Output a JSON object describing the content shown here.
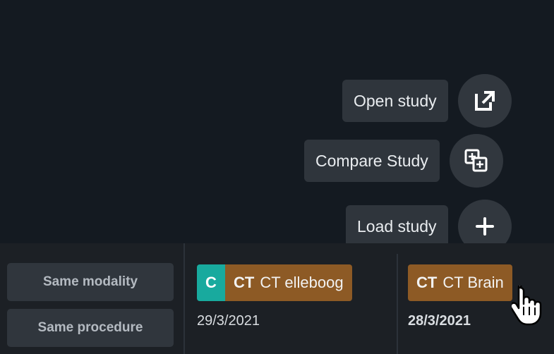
{
  "actions": {
    "open": {
      "label": "Open study",
      "icon": "external-link-icon"
    },
    "compare": {
      "label": "Compare Study",
      "icon": "compare-icon"
    },
    "load": {
      "label": "Load study",
      "icon": "plus-icon"
    }
  },
  "filters": {
    "same_modality": "Same modality",
    "same_procedure": "Same procedure"
  },
  "studies": [
    {
      "compare_badge": "C",
      "modality": "CT",
      "description": "CT elleboog",
      "date": "29/3/2021"
    },
    {
      "modality": "CT",
      "description": "CT Brain",
      "date": "28/3/2021"
    }
  ],
  "colors": {
    "compare_badge": "#18aa9e",
    "study_chip": "#8d5a25",
    "background_top": "#141a21",
    "button": "#31373e"
  }
}
